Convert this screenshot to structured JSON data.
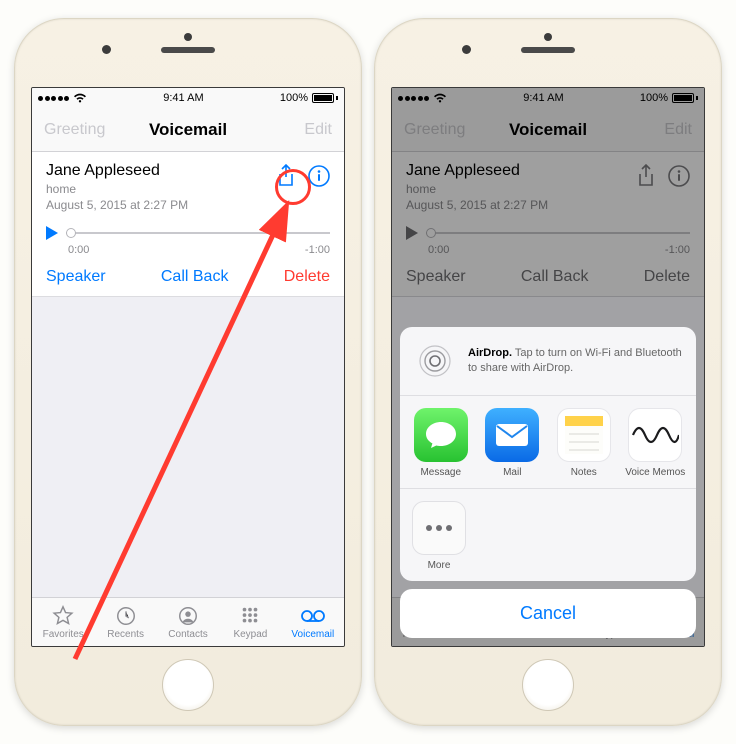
{
  "status": {
    "time": "9:41 AM",
    "battery_text": "100%"
  },
  "nav": {
    "left": "Greeting",
    "title": "Voicemail",
    "right": "Edit"
  },
  "voicemail": {
    "name": "Jane Appleseed",
    "line_label": "home",
    "date": "August 5, 2015 at 2:27 PM",
    "current_time": "0:00",
    "remaining": "-1:00",
    "speaker": "Speaker",
    "callback": "Call Back",
    "delete": "Delete"
  },
  "tabs": {
    "favorites": "Favorites",
    "recents": "Recents",
    "contacts": "Contacts",
    "keypad": "Keypad",
    "voicemail": "Voicemail"
  },
  "share": {
    "airdrop_label": "AirDrop.",
    "airdrop_desc": "Tap to turn on Wi-Fi and Bluetooth to share with AirDrop.",
    "apps": {
      "message": "Message",
      "mail": "Mail",
      "notes": "Notes",
      "voicememos": "Voice Memos"
    },
    "more": "More",
    "cancel": "Cancel"
  },
  "annotation": {
    "target": "share-icon"
  }
}
